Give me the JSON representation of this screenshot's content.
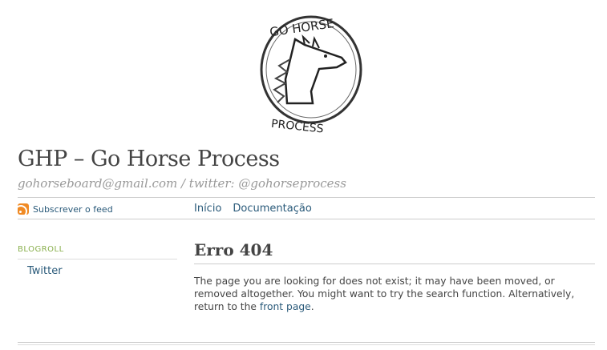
{
  "header": {
    "logo_text_top": "GO HORSE",
    "logo_text_bottom": "PROCESS",
    "site_title": "GHP – Go Horse Process",
    "site_description": "gohorseboard@gmail.com / twitter: @gohorseprocess"
  },
  "feed": {
    "icon": "rss-icon",
    "label": "Subscrever o feed"
  },
  "nav": {
    "items": [
      {
        "label": "Início"
      },
      {
        "label": "Documentação"
      }
    ]
  },
  "sidebar": {
    "heading": "BLOGROLL",
    "links": [
      {
        "label": "Twitter"
      }
    ]
  },
  "post": {
    "title": "Erro 404",
    "body_before_link": "The page you are looking for does not exist; it may have been moved, or removed altogether. You might want to try the search function. Alternatively, return to the ",
    "link_label": "front page",
    "body_after_link": "."
  }
}
